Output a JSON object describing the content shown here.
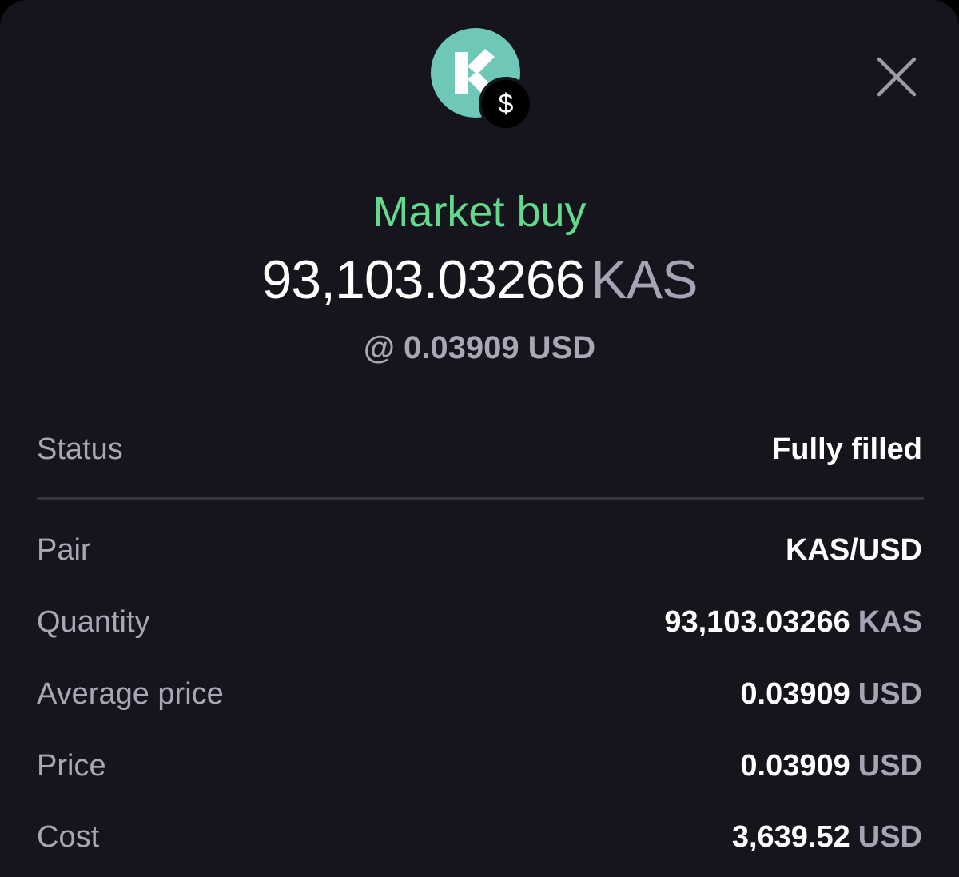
{
  "header": {
    "asset_icon": "kaspa-logo-icon",
    "quote_badge": "$",
    "close_icon": "close-icon"
  },
  "order": {
    "type_label": "Market buy",
    "amount": "93,103.03266",
    "amount_unit": "KAS",
    "rate_text": "@ 0.03909 USD"
  },
  "details": {
    "status": {
      "label": "Status",
      "value": "Fully filled"
    },
    "pair": {
      "label": "Pair",
      "value": "KAS/USD"
    },
    "quantity": {
      "label": "Quantity",
      "value": "93,103.03266",
      "unit": "KAS"
    },
    "average_price": {
      "label": "Average price",
      "value": "0.03909",
      "unit": "USD"
    },
    "price": {
      "label": "Price",
      "value": "0.03909",
      "unit": "USD"
    },
    "cost": {
      "label": "Cost",
      "value": "3,639.52",
      "unit": "USD"
    }
  },
  "colors": {
    "background": "#16141d",
    "accent_green": "#62d98c",
    "icon_teal": "#6fc7b7",
    "muted_text": "#a9a7b5"
  }
}
